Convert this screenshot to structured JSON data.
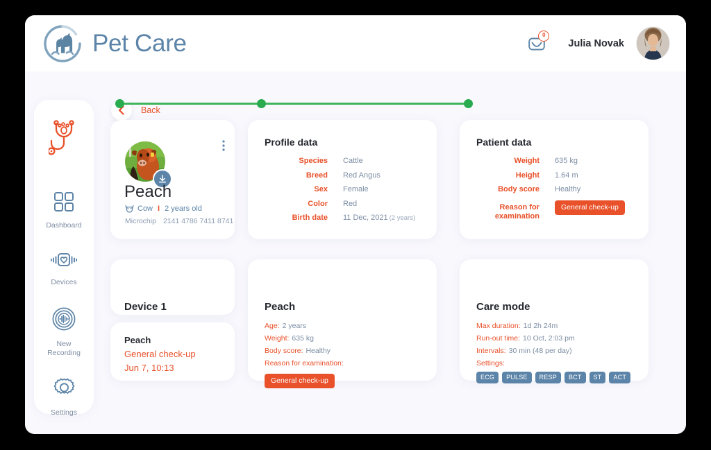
{
  "app": {
    "brand_name": "Pet Care",
    "brand_logo_icon": "pet-care-logo-icon"
  },
  "header": {
    "mail_icon": "mail-icon",
    "mail_badge_count": "0",
    "user_name": "Julia Novak",
    "avatar_icon": "user-avatar"
  },
  "sidebar": {
    "logo_icon": "stethoscope-paw-icon",
    "items": [
      {
        "label": "Dashboard",
        "icon": "grid-icon"
      },
      {
        "label": "Devices",
        "icon": "device-heart-icon"
      },
      {
        "label": "New\nRecording",
        "label_line1": "New",
        "label_line2": "Recording",
        "icon": "recording-waveform-icon"
      },
      {
        "label": "Settings",
        "icon": "gear-icon"
      }
    ]
  },
  "main": {
    "back": {
      "label": "Back",
      "icon": "chevron-left-icon"
    },
    "pet_card": {
      "photo_icon": "pet-photo",
      "download_icon": "download-icon",
      "menu_icon": "kebab-menu-icon",
      "name": "Peach",
      "species_icon": "cow-head-icon",
      "species": "Cow",
      "separator": "I",
      "age": "2 years old",
      "microchip_label": "Microchip",
      "microchip_value": "2141 4786 7411 8741"
    },
    "profile_card": {
      "title": "Profile data",
      "rows": [
        {
          "key": "Species",
          "value": "Cattle"
        },
        {
          "key": "Breed",
          "value": "Red Angus"
        },
        {
          "key": "Sex",
          "value": "Female"
        },
        {
          "key": "Color",
          "value": "Red"
        },
        {
          "key": "Birth date",
          "value": "11 Dec, 2021",
          "sub": "(2 years)"
        }
      ]
    },
    "patient_card": {
      "title": "Patient data",
      "rows": [
        {
          "key": "Weight",
          "value": "635 kg"
        },
        {
          "key": "Height",
          "value": "1.64 m"
        },
        {
          "key": "Body score",
          "value": "Healthy"
        }
      ],
      "reason_key_line1": "Reason for",
      "reason_key_line2": "examination",
      "reason_tag": "General check-up"
    },
    "device_card": {
      "title": "Device 1"
    },
    "record_card": {
      "name": "Peach",
      "reason": "General check-up",
      "date": "Jun 7, 10:13"
    },
    "peach_card": {
      "title": "Peach",
      "rows": [
        {
          "key": "Age:",
          "value": "2 years"
        },
        {
          "key": "Weight:",
          "value": "635 kg"
        },
        {
          "key": "Body score:",
          "value": "Healthy"
        },
        {
          "key": "Reason for examination:",
          "value": ""
        }
      ],
      "tag": "General check-up"
    },
    "care_card": {
      "title": "Care mode",
      "rows": [
        {
          "key": "Max duration:",
          "value": "1d 2h 24m"
        },
        {
          "key": "Run-out time:",
          "value": "10 Oct, 2:03 pm"
        },
        {
          "key": "Intervals:",
          "value": "30 min (48 per day)"
        },
        {
          "key": "Settings:",
          "value": ""
        }
      ],
      "chips": [
        "ECG",
        "PULSE",
        "RESP",
        "BCT",
        "ST",
        "ACT"
      ]
    },
    "timeline_color": "#3eb55c"
  },
  "colors": {
    "accent_orange": "#e8512a",
    "steel_blue": "#5c84a8",
    "muted_text": "#7b8da3",
    "page_bg": "#f8f8fd",
    "green": "#3eb55c"
  }
}
